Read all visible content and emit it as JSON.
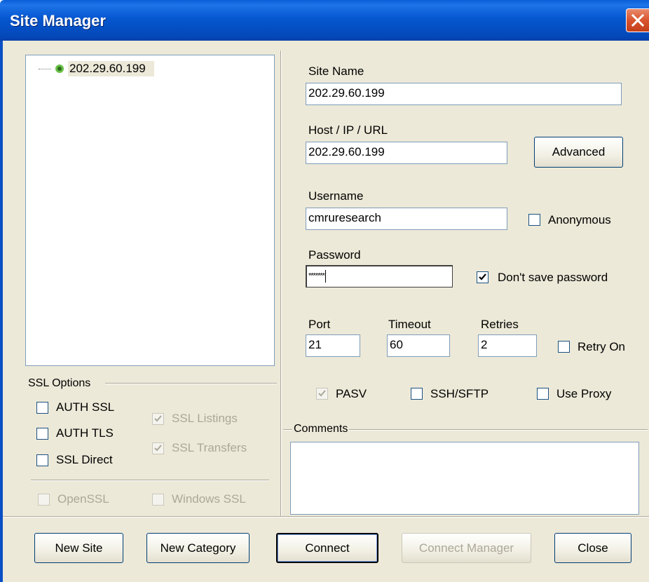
{
  "window": {
    "title": "Site Manager"
  },
  "tree": {
    "items": [
      {
        "label": "202.29.60.199"
      }
    ]
  },
  "fields": {
    "site_name": {
      "label": "Site Name",
      "value": "202.29.60.199"
    },
    "host": {
      "label": "Host / IP / URL",
      "value": "202.29.60.199"
    },
    "username": {
      "label": "Username",
      "value": "cmruresearch"
    },
    "password": {
      "label": "Password",
      "value": "*******"
    },
    "port": {
      "label": "Port",
      "value": "21"
    },
    "timeout": {
      "label": "Timeout",
      "value": "60"
    },
    "retries": {
      "label": "Retries",
      "value": "2"
    },
    "comments": {
      "label": "Comments",
      "value": ""
    }
  },
  "buttons": {
    "advanced": "Advanced",
    "new_site": "New Site",
    "new_category": "New Category",
    "connect": "Connect",
    "connect_manager": "Connect Manager",
    "close": "Close"
  },
  "checkboxes": {
    "anonymous": {
      "label": "Anonymous",
      "checked": false,
      "enabled": true
    },
    "dont_save_password": {
      "label": "Don't save password",
      "checked": true,
      "enabled": true
    },
    "retry_on": {
      "label": "Retry On",
      "checked": false,
      "enabled": true
    },
    "pasv": {
      "label": "PASV",
      "checked": true,
      "enabled": false
    },
    "ssh_sftp": {
      "label": "SSH/SFTP",
      "checked": false,
      "enabled": true
    },
    "use_proxy": {
      "label": "Use Proxy",
      "checked": false,
      "enabled": true
    }
  },
  "ssl": {
    "group_label": "SSL Options",
    "auth_ssl": {
      "label": "AUTH SSL",
      "checked": false,
      "enabled": true
    },
    "auth_tls": {
      "label": "AUTH TLS",
      "checked": false,
      "enabled": true
    },
    "ssl_direct": {
      "label": "SSL Direct",
      "checked": false,
      "enabled": true
    },
    "ssl_listings": {
      "label": "SSL Listings",
      "checked": true,
      "enabled": false
    },
    "ssl_transfers": {
      "label": "SSL Transfers",
      "checked": true,
      "enabled": false
    },
    "openssl": {
      "label": "OpenSSL",
      "checked": false,
      "enabled": false
    },
    "windows_ssl": {
      "label": "Windows SSL",
      "checked": false,
      "enabled": false
    }
  },
  "colors": {
    "titlebar": "#0557d0",
    "dialog_bg": "#ece9d8",
    "close": "#d9532e"
  }
}
